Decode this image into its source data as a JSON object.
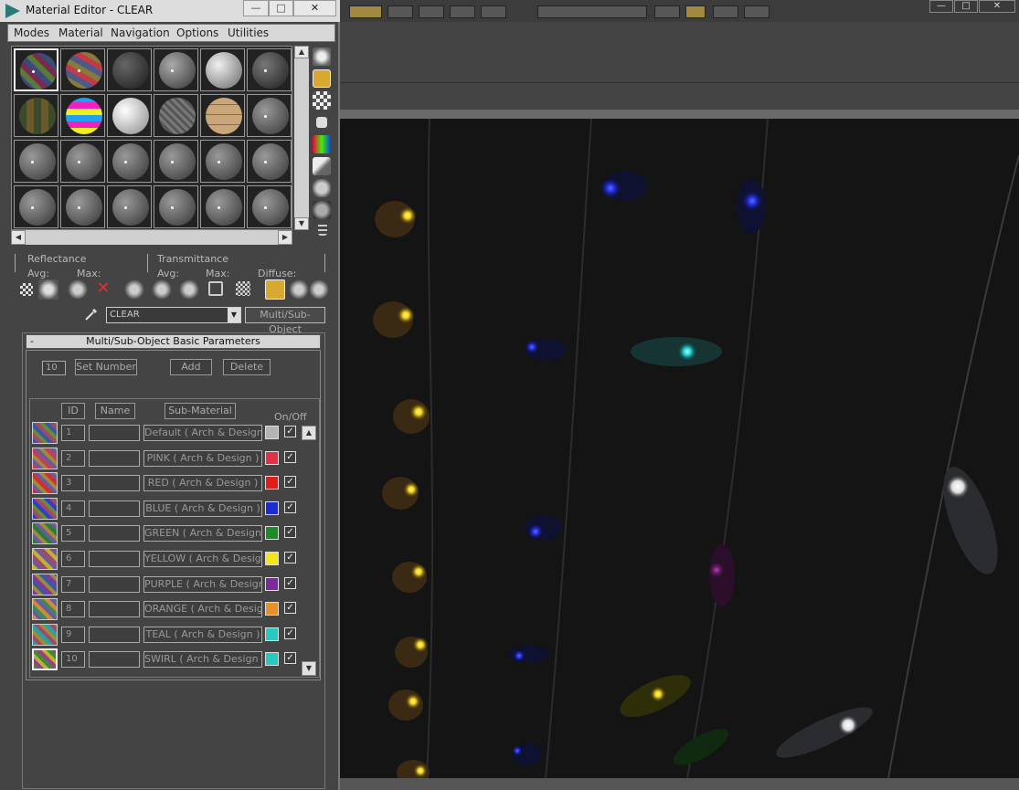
{
  "window": {
    "title": "Material Editor - CLEAR",
    "min_label": "—",
    "max_label": "□",
    "close_label": "✕"
  },
  "menu": [
    "Modes",
    "Material",
    "Navigation",
    "Options",
    "Utilities"
  ],
  "info": {
    "reflectance": "Reflectance",
    "transmittance": "Transmittance",
    "avg": "Avg:",
    "max": "Max:",
    "diffuse": "Diffuse:"
  },
  "material_name": "CLEAR",
  "material_type": "Multi/Sub-Object",
  "rollout": {
    "title": "Multi/Sub-Object Basic Parameters",
    "collapse": "-",
    "count": "10",
    "set_number": "Set Number",
    "add": "Add",
    "delete": "Delete",
    "col_id": "ID",
    "col_name": "Name",
    "col_submaterial": "Sub-Material",
    "col_onoff": "On/Off"
  },
  "submaterials": [
    {
      "id": "1",
      "name": "",
      "material": "Default  ( Arch & Design )",
      "color": "#b4b4b4",
      "on": "✓"
    },
    {
      "id": "2",
      "name": "",
      "material": "PINK  ( Arch & Design )",
      "color": "#e0304a",
      "on": "✓"
    },
    {
      "id": "3",
      "name": "",
      "material": "RED  ( Arch & Design )",
      "color": "#e01c1c",
      "on": "✓"
    },
    {
      "id": "4",
      "name": "",
      "material": "BLUE  ( Arch & Design )",
      "color": "#1b2bd6",
      "on": "✓"
    },
    {
      "id": "5",
      "name": "",
      "material": "GREEN  ( Arch & Design )",
      "color": "#1f8a2a",
      "on": "✓"
    },
    {
      "id": "6",
      "name": "",
      "material": "YELLOW  ( Arch & Design )",
      "color": "#f2e61a",
      "on": "✓"
    },
    {
      "id": "7",
      "name": "",
      "material": "PURPLE  ( Arch & Design )",
      "color": "#7a2a9a",
      "on": "✓"
    },
    {
      "id": "8",
      "name": "",
      "material": "ORANGE  ( Arch & Design )",
      "color": "#e8902a",
      "on": "✓"
    },
    {
      "id": "9",
      "name": "",
      "material": "TEAL  ( Arch & Design )",
      "color": "#2ac8c0",
      "on": "✓"
    },
    {
      "id": "10",
      "name": "",
      "material": "SWIRL  ( Arch & Design )",
      "color": "#2ac8c0",
      "on": "✓"
    }
  ],
  "scroll_up": "▲",
  "scroll_down": "▼",
  "scroll_left": "◀",
  "scroll_right": "▶"
}
